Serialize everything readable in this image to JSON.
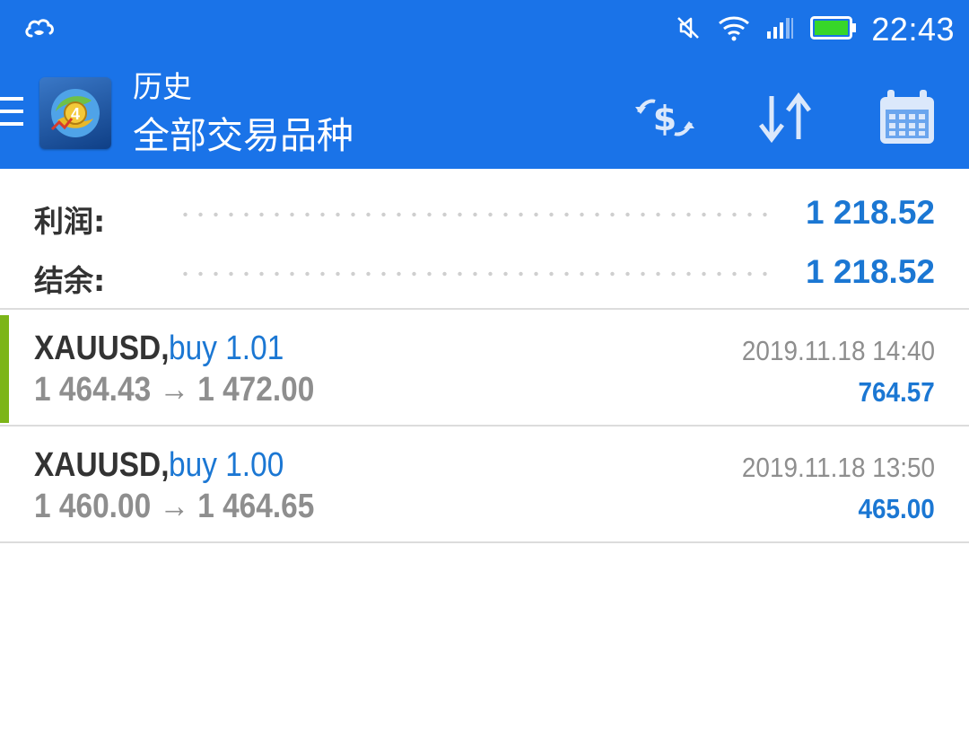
{
  "status_bar": {
    "time": "22:43",
    "icons": [
      "cloud-icon",
      "mute-icon",
      "wifi-icon",
      "signal-icon",
      "battery-icon"
    ],
    "battery_color": "#37d62a"
  },
  "app_bar": {
    "title_small": "历史",
    "title_large": "全部交易品种",
    "logo_badge": "4",
    "background": "#1a73e8",
    "actions": [
      "currency-exchange-icon",
      "sort-icon",
      "calendar-icon"
    ]
  },
  "summary": {
    "profit_label": "利润:",
    "profit_value": "1 218.52",
    "balance_label": "结余:",
    "balance_value": "1 218.52"
  },
  "trades": [
    {
      "symbol": "XAUUSD,",
      "side": "buy 1.01",
      "prices": "1 464.43 → 1 472.00",
      "time": "2019.11.18 14:40",
      "profit": "764.57",
      "indicator_color": "#7cb518"
    },
    {
      "symbol": "XAUUSD,",
      "side": "buy 1.00",
      "prices": "1 460.00 → 1 464.65",
      "time": "2019.11.18 13:50",
      "profit": "465.00"
    }
  ]
}
